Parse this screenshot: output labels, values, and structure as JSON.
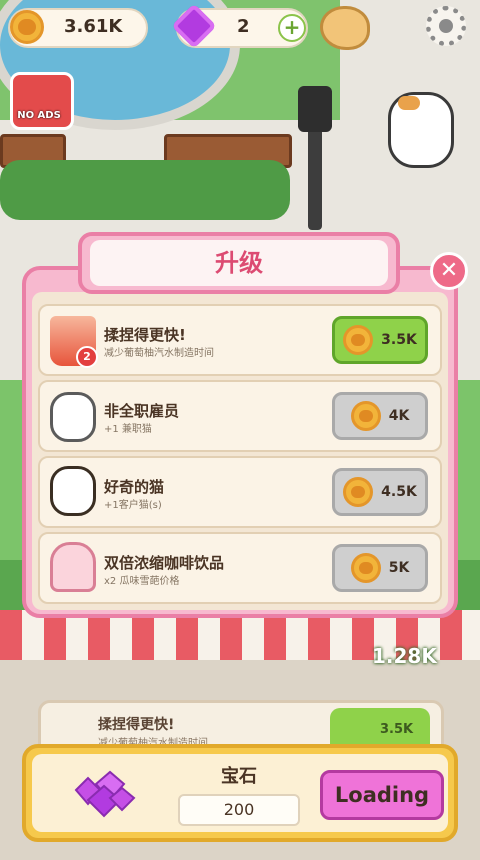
{
  "hud": {
    "coins": "3.61K",
    "gems": "2",
    "no_ads_label": "NO ADS"
  },
  "background": {
    "coin_amount": "1.28K",
    "card_title": "揉捏得更快!",
    "card_subtitle": "减少葡萄柚汽水制造时间",
    "card_price": "3.5K"
  },
  "modal": {
    "title": "升级",
    "close": "✕",
    "upgrades": [
      {
        "title": "揉捏得更快!",
        "subtitle": "减少葡萄柚汽水制造时间",
        "price": "3.5K",
        "state": "available",
        "badge": "2"
      },
      {
        "title": "非全职雇员",
        "subtitle": "+1 兼职猫",
        "price": "4K",
        "state": "locked"
      },
      {
        "title": "好奇的猫",
        "subtitle": "+1客户猫(s)",
        "price": "4.5K",
        "state": "locked"
      },
      {
        "title": "双倍浓缩咖啡饮品",
        "subtitle": "x2 瓜味雪葩价格",
        "price": "5K",
        "state": "locked"
      }
    ]
  },
  "shop": {
    "title": "宝石",
    "quantity": "200",
    "button_label": "Loading"
  },
  "colors": {
    "accent_pink": "#ea7fa6",
    "title_pink": "#dc4b72",
    "buy_green": "#8fd24a",
    "loading_magenta": "#ef73d8"
  }
}
